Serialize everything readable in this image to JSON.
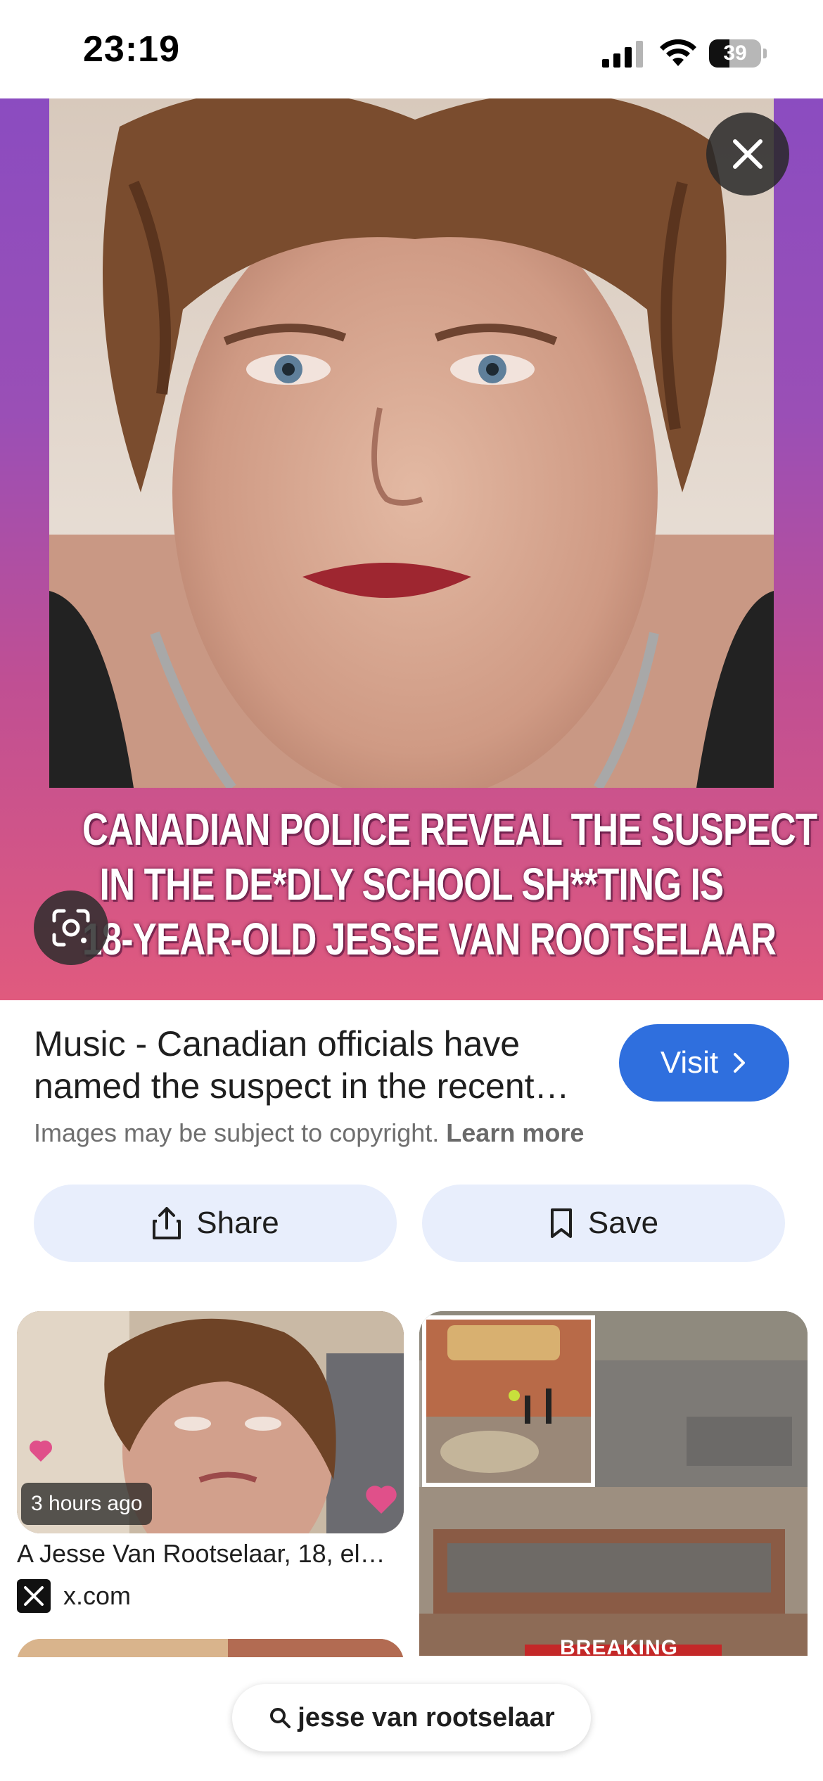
{
  "status_bar": {
    "time": "23:19",
    "battery_level": "39",
    "battery_fraction": 0.39
  },
  "hero": {
    "caption_lines": [
      "CANADIAN POLICE REVEAL THE SUSPECT",
      "IN THE DE*DLY SCHOOL SH**TING IS",
      "18-YEAR-OLD JESSE VAN ROOTSELAAR"
    ],
    "close_icon": "close-icon",
    "lens_icon": "google-lens-icon"
  },
  "result": {
    "title": "Music - Canadian officials have named the suspect in the recent…",
    "visit_label": "Visit",
    "copyright_text": "Images may be subject to copyright.",
    "learn_more": "Learn more"
  },
  "actions": {
    "share_label": "Share",
    "save_label": "Save"
  },
  "grid": {
    "card1": {
      "time_badge": "3 hours ago",
      "caption": "A Jesse Van Rootselaar, 18, el…",
      "source": "x.com"
    },
    "card2": {
      "overlay_text": "BREAKING"
    }
  },
  "search": {
    "query": "jesse van rootselaar"
  },
  "colors": {
    "accent": "#2f6fde",
    "action_bg": "#e8eefc",
    "hero_purple": "#8b4cc0",
    "hero_pink": "#e05a7e"
  }
}
